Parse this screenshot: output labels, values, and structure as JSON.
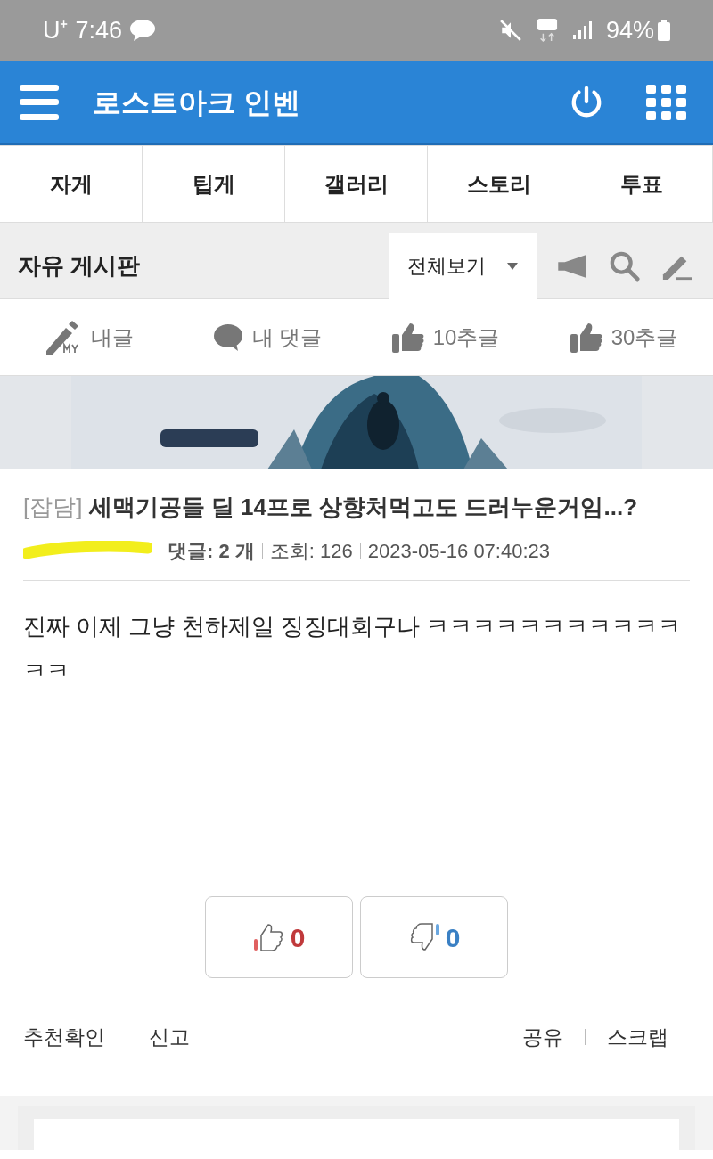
{
  "status_bar": {
    "carrier": "U⁺",
    "time": "7:46",
    "battery": "94%"
  },
  "app_bar": {
    "title": "로스트아크 인벤"
  },
  "tabs": [
    {
      "label": "자게"
    },
    {
      "label": "팁게"
    },
    {
      "label": "갤러리"
    },
    {
      "label": "스토리"
    },
    {
      "label": "투표"
    }
  ],
  "board": {
    "title": "자유 게시판",
    "filter": "전체보기"
  },
  "quick_links": [
    {
      "kind": "my-post",
      "label": "내글"
    },
    {
      "kind": "comment",
      "label": "내 댓글"
    },
    {
      "kind": "like",
      "label": "10추글"
    },
    {
      "kind": "like",
      "label": "30추글"
    }
  ],
  "post": {
    "category": "[잡담]",
    "title": "세맥기공들 딜 14프로 상향처먹고도 드러누운거임...?",
    "comments_label": "댓글:",
    "comments": "2 개",
    "views": "조회: 126",
    "date": "2023-05-16 07:40:23",
    "body": "진짜 이제 그냥 천하제일 징징대회구나 ㅋㅋㅋㅋㅋㅋㅋㅋㅋㅋㅋㅋㅋ"
  },
  "votes": {
    "up": "0",
    "down": "0"
  },
  "footer_left": [
    "추천확인",
    "신고"
  ],
  "footer_right": [
    "공유",
    "스크랩"
  ]
}
